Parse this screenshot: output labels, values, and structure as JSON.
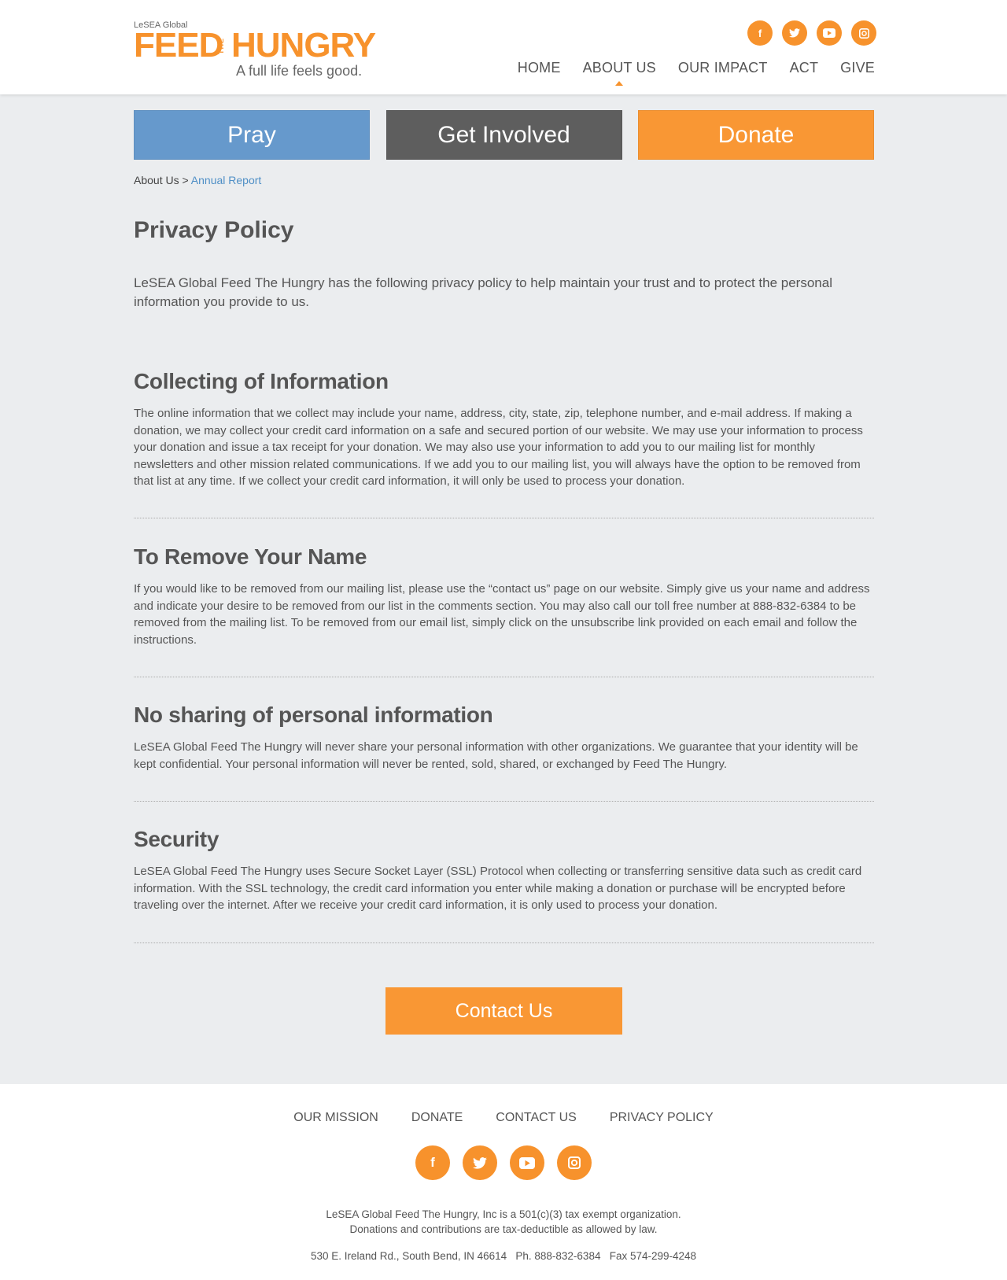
{
  "logo": {
    "small": "LeSEA Global",
    "feed": "FEED",
    "the": "THE",
    "hungry": "HUNGRY",
    "tagline": "A full life feels good."
  },
  "social": {
    "facebook": "f",
    "twitter": "t",
    "youtube": "▶",
    "instagram": "◘"
  },
  "nav": {
    "home": "HOME",
    "about": "ABOUT US",
    "impact": "OUR IMPACT",
    "act": "ACT",
    "give": "GIVE"
  },
  "actions": {
    "pray": "Pray",
    "involved": "Get Involved",
    "donate": "Donate"
  },
  "breadcrumb": {
    "parent": "About Us",
    "sep": " > ",
    "current": "Annual Report"
  },
  "page": {
    "title": "Privacy Policy",
    "intro": "LeSEA Global Feed The Hungry has the following privacy policy to help maintain your trust and to protect the personal information you provide to us."
  },
  "sections": [
    {
      "heading": "Collecting of Information",
      "body": "The online information that we collect may include your name, address, city, state, zip, telephone number, and e-mail address. If making a donation, we may collect your credit card information on a safe and secured portion of our website. We may use your information to process your donation and issue a tax receipt for your donation. We may also use your information to add you to our mailing list for monthly newsletters and other mission related communications. If we add you to our mailing list, you will always have the option to be removed from that list at any time. If we collect your credit card information, it will only be used to process your donation."
    },
    {
      "heading": "To Remove Your Name",
      "body": "If you would like to be removed from our mailing list, please use the “contact us” page on our website. Simply give us your name and address and indicate your desire to be removed from our list in the comments section. You may also call our toll free number at 888-832-6384 to be removed from the mailing list. To be removed from our email list, simply click on the unsubscribe link provided on each email and follow the instructions."
    },
    {
      "heading": "No sharing of personal information",
      "body": "LeSEA Global Feed The Hungry will never share your personal information with other organizations. We guarantee that your identity will be kept confidential. Your personal information will never be rented, sold, shared, or exchanged by Feed The Hungry."
    },
    {
      "heading": "Security",
      "body": "LeSEA Global Feed The Hungry uses Secure Socket Layer (SSL) Protocol when collecting or transferring sensitive data such as credit card information. With the SSL technology, the credit card information you enter while making a donation or purchase will be encrypted before traveling over the internet. After we receive your credit card information, it is only used to process your donation."
    }
  ],
  "contact_button": "Contact Us",
  "footer": {
    "nav": {
      "mission": "OUR MISSION",
      "donate": "DONATE",
      "contact": "CONTACT US",
      "privacy": "PRIVACY POLICY"
    },
    "line1": "LeSEA Global Feed The Hungry, Inc is a 501(c)(3) tax exempt organization.",
    "line2": "Donations and contributions are tax-deductible as allowed by law.",
    "address": "530 E. Ireland Rd., South Bend, IN 46614   Ph. 888-832-6384   Fax 574-299-4248"
  },
  "colors": {
    "brand_orange": "#f7922c",
    "pray_blue": "#6699cc",
    "involved_gray": "#5e5e5e",
    "link_blue": "#4f8fc6"
  }
}
